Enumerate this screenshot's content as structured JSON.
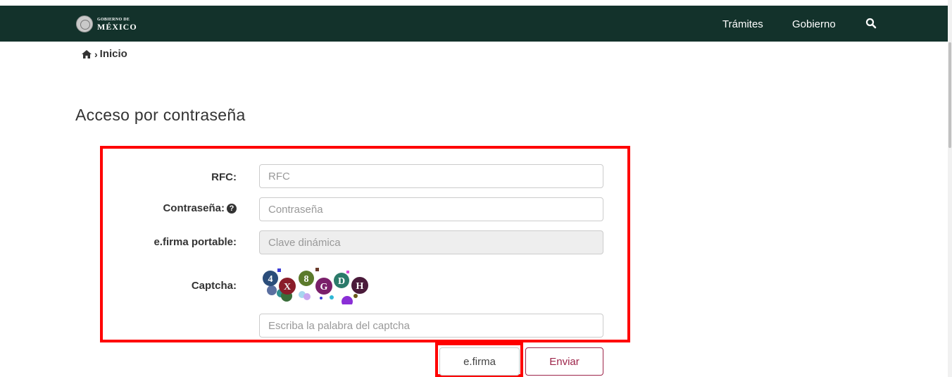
{
  "header": {
    "logo_line1": "GOBIERNO DE",
    "logo_line2": "MÉXICO",
    "nav": [
      "Trámites",
      "Gobierno"
    ],
    "search_icon": "search-icon"
  },
  "breadcrumb": {
    "home_icon": "home-icon",
    "separator": "›",
    "current": "Inicio"
  },
  "page": {
    "title": "Acceso por contraseña"
  },
  "form": {
    "rfc_label": "RFC:",
    "rfc_placeholder": "RFC",
    "password_label": "Contraseña:",
    "password_placeholder": "Contraseña",
    "help_icon": "question-circle-icon",
    "efirma_label": "e.firma portable:",
    "efirma_placeholder": "Clave dinámica",
    "captcha_label": "Captcha:",
    "captcha_placeholder": "Escriba la palabra del captcha",
    "captcha_chars": [
      "4",
      "X",
      "8",
      "G",
      "D",
      "H"
    ]
  },
  "buttons": {
    "efirma": "e.firma",
    "enviar": "Enviar"
  },
  "colors": {
    "navbar": "#13322b",
    "accent": "#9d2449",
    "highlight": "#ff0000"
  }
}
